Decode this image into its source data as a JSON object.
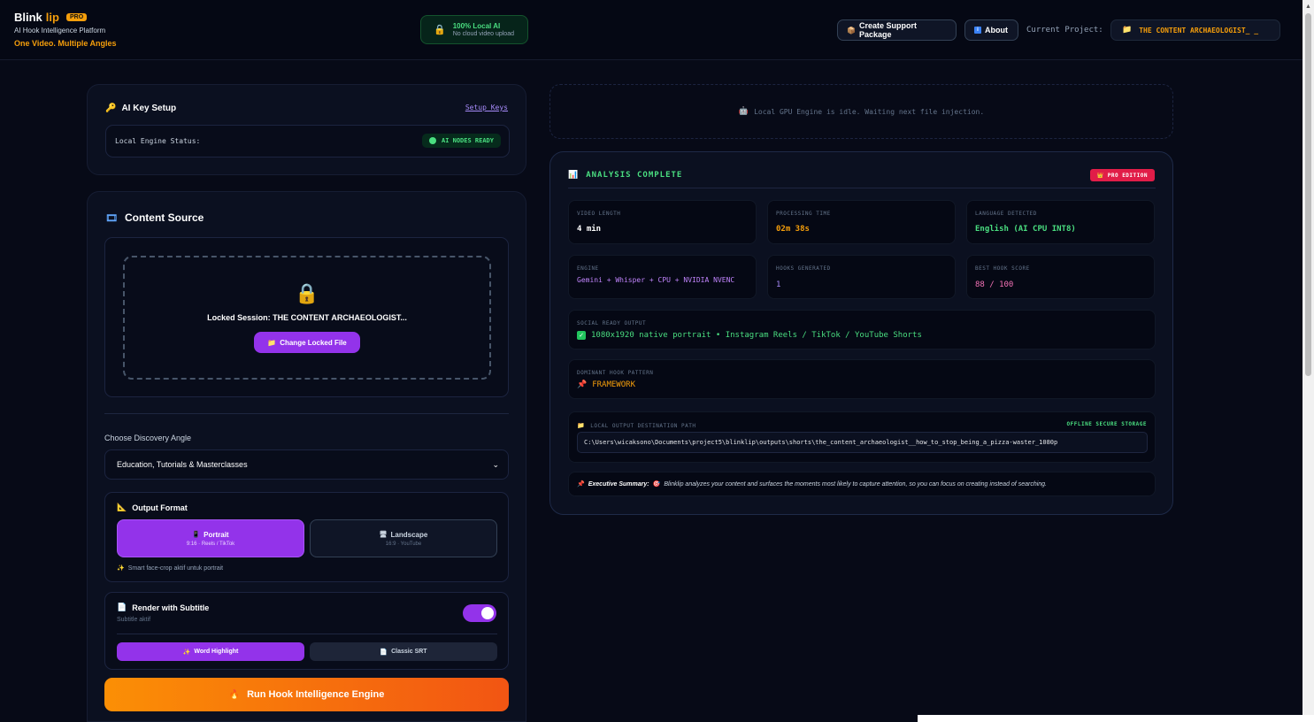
{
  "header": {
    "brand_name_1": "Blink",
    "brand_name_2": "lip",
    "pro_tag": "PRO",
    "subtitle": "AI Hook Intelligence Platform",
    "tagline": "One Video. Multiple Angles",
    "local_badge_title": "100% Local AI",
    "local_badge_sub": "No cloud video upload",
    "support_button": "Create Support Package",
    "about_button": "About",
    "current_project_label": "Current Project:",
    "current_project_value": "THE CONTENT ARCHAEOLOGIST_ _"
  },
  "ai_key": {
    "title": "AI Key Setup",
    "setup_link": "Setup Keys",
    "status_label": "Local Engine Status:",
    "status_value": "AI NODES READY"
  },
  "content_source": {
    "title": "Content Source",
    "locked_text": "Locked Session: THE CONTENT ARCHAEOLOGIST...",
    "change_button": "Change Locked File",
    "angle_label": "Choose Discovery Angle",
    "angle_value": "Education, Tutorials & Masterclasses",
    "output_format_title": "Output Format",
    "portrait_label": "Portrait",
    "portrait_sub": "9:16 · Reels / TikTok",
    "landscape_label": "Landscape",
    "landscape_sub": "16:9 · YouTube",
    "format_hint": "Smart face-crop aktif untuk portrait",
    "subtitle_title": "Render with Subtitle",
    "subtitle_note": "Subtitle aktif",
    "word_highlight": "Word Highlight",
    "classic_srt": "Classic SRT",
    "run_button": "Run Hook Intelligence Engine"
  },
  "engine_idle": "Local GPU Engine is idle. Waiting next file injection.",
  "analysis": {
    "title": "ANALYSIS COMPLETE",
    "badge": "PRO EDITION",
    "stats": [
      {
        "label": "VIDEO LENGTH",
        "value": "4 min",
        "color": "#ffffff"
      },
      {
        "label": "PROCESSING TIME",
        "value": "02m 38s",
        "color": "#f59e0b"
      },
      {
        "label": "LANGUAGE DETECTED",
        "value": "English (AI CPU INT8)",
        "color": "#4ade80"
      },
      {
        "label": "ENGINE",
        "value": "Gemini + Whisper + CPU + NVIDIA NVENC",
        "color": "#c084fc"
      },
      {
        "label": "HOOKS GENERATED",
        "value": "1",
        "color": "#a78bfa"
      },
      {
        "label": "BEST HOOK SCORE",
        "value": "88 / 100",
        "color": "#f472b6"
      }
    ],
    "social_label": "SOCIAL READY OUTPUT",
    "social_value": "1080x1920 native portrait • Instagram Reels / TikTok / YouTube Shorts",
    "pattern_label": "DOMINANT HOOK PATTERN",
    "pattern_value": "FRAMEWORK",
    "path_label": "LOCAL OUTPUT DESTINATION PATH",
    "path_badge": "OFFLINE SECURE STORAGE",
    "path_value": "C:\\Users\\wicaksono\\Documents\\project5\\blinklip\\outputs\\shorts\\the_content_archaeologist__how_to_stop_being_a_pizza-waster_1080p",
    "summary_label": "Executive Summary:",
    "summary_text": "Blinklip analyzes your content and surfaces the moments most likely to capture attention, so you can focus on creating instead of searching."
  }
}
